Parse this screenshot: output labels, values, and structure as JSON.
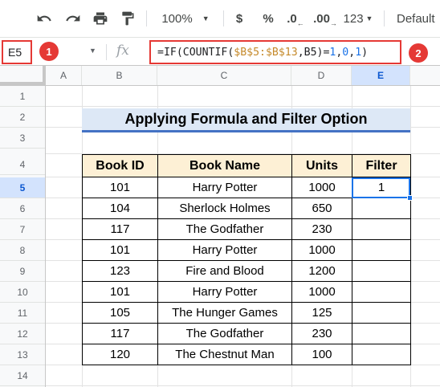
{
  "toolbar": {
    "zoom": "100%",
    "currency": "$",
    "percent": "%",
    "decrease_decimal": ".0",
    "increase_decimal": ".00",
    "number_format": "123",
    "font": "Default"
  },
  "formula_bar": {
    "cell_ref": "E5",
    "badge_1": "1",
    "badge_2": "2",
    "fx": "fx",
    "formula_prefix": "=IF(COUNTIF(",
    "formula_range": "$B$5:$B$13",
    "formula_mid": ",B5)=",
    "formula_n1": "1",
    "formula_c1": ",",
    "formula_n2": "0",
    "formula_c2": ",",
    "formula_n3": "1",
    "formula_end": ")"
  },
  "columns": [
    "A",
    "B",
    "C",
    "D",
    "E"
  ],
  "rows": [
    "1",
    "2",
    "3",
    "4",
    "5",
    "6",
    "7",
    "8",
    "9",
    "10",
    "11",
    "12",
    "13",
    "14"
  ],
  "title": "Applying Formula and Filter Option",
  "table": {
    "headers": [
      "Book ID",
      "Book Name",
      "Units",
      "Filter"
    ],
    "rows": [
      [
        "101",
        "Harry Potter",
        "1000",
        "1"
      ],
      [
        "104",
        "Sherlock Holmes",
        "650",
        ""
      ],
      [
        "117",
        "The Godfather",
        "230",
        ""
      ],
      [
        "101",
        "Harry Potter",
        "1000",
        ""
      ],
      [
        "123",
        "Fire and Blood",
        "1200",
        ""
      ],
      [
        "101",
        "Harry Potter",
        "1000",
        ""
      ],
      [
        "105",
        "The Hunger Games",
        "125",
        ""
      ],
      [
        "117",
        "The Godfather",
        "230",
        ""
      ],
      [
        "120",
        "The Chestnut Man",
        "100",
        ""
      ]
    ]
  },
  "colors": {
    "accent": "#1a73e8",
    "highlight_red": "#e53935",
    "title_bg": "#dde8f6",
    "header_bg": "#fdf0d5"
  }
}
